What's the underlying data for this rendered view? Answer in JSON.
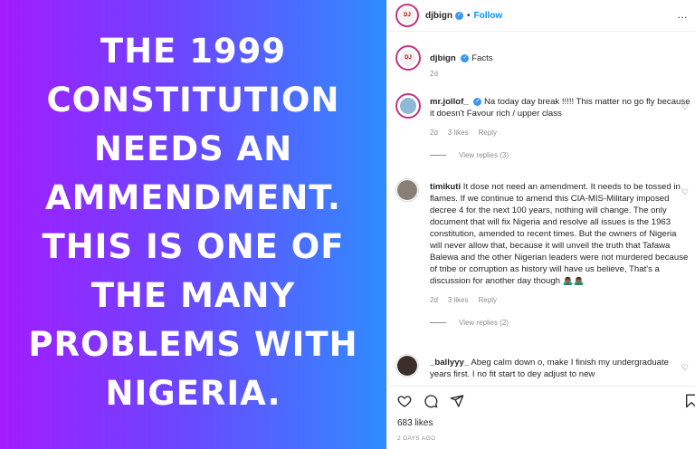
{
  "post_image": {
    "lines": [
      "THE 1999",
      "CONSTITUTION",
      "NEEDS AN",
      "AMMENDMENT.",
      "THIS IS ONE OF",
      "THE MANY",
      "PROBLEMS WITH",
      "NIGERIA."
    ]
  },
  "header": {
    "username": "djbign",
    "separator": "•",
    "follow_label": "Follow",
    "more": "…"
  },
  "caption": {
    "username": "djbign",
    "text": "Facts",
    "time": "2d"
  },
  "comments": [
    {
      "username": "mr.jollof_",
      "text": "Na today day break !!!!! This matter no go fly because it doesn't Favour rich / upper class",
      "time": "2d",
      "likes": "3 likes",
      "reply": "Reply",
      "view_replies": "View replies (3)"
    },
    {
      "username": "timikuti",
      "text": "It dose not need an amendment. It needs to be tossed in flames. If we continue to amend this CIA-MIS-Military imposed decree 4 for the next 100 years, nothing will change. The only document that will fix Nigeria and resolve all issues is the 1963 constitution, amended to recent times. But the owners of Nigeria will never allow that, because it will unveil the truth that Tafawa Balewa and the other Nigerian leaders were not murdered because of tribe or corruption as history will have us believe, That's a discussion for another day though 🙇🏾‍♂️🙇🏾‍♂️",
      "time": "2d",
      "likes": "3 likes",
      "reply": "Reply",
      "view_replies": "View replies (2)"
    },
    {
      "username": "_ballyyy_",
      "text": "Abeg calm down o, make I finish my undergraduate years first. I no fit start to dey adjust to new"
    }
  ],
  "likes": "683 likes",
  "date": "2 DAYS AGO",
  "colors": {
    "accent": "#0095f6",
    "gradient_start": "#a21cff",
    "gradient_end": "#2f8cff"
  }
}
